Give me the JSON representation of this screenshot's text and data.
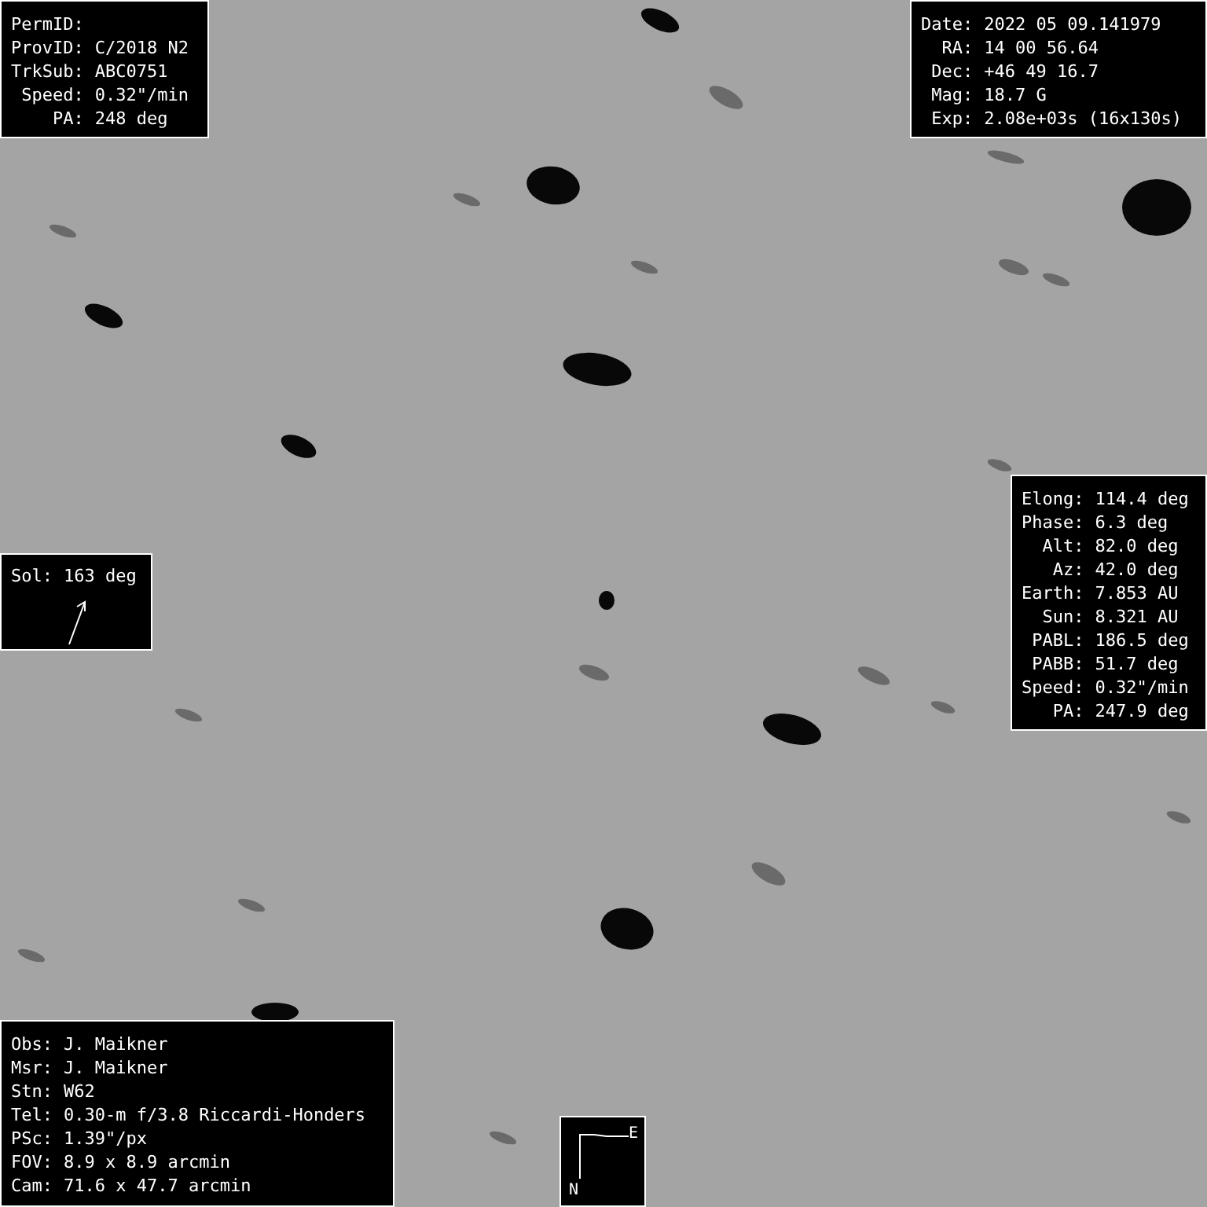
{
  "target_panel": {
    "rows": [
      {
        "label": "PermID:"
      },
      {
        "label": "ProvID:",
        "value": "C/2018 N2"
      },
      {
        "label": "TrkSub:",
        "value": "ABC0751"
      },
      {
        "label": "Speed:",
        "value": "0.32\"/min"
      },
      {
        "label": "PA:",
        "value": "248 deg"
      }
    ]
  },
  "observation_panel": {
    "rows": [
      {
        "label": "Date:",
        "value": "2022 05 09.141979"
      },
      {
        "label": "RA:",
        "value": "14 00 56.64"
      },
      {
        "label": "Dec:",
        "value": "+46 49 16.7"
      },
      {
        "label": "Mag:",
        "value": "18.7 G"
      },
      {
        "label": "Exp:",
        "value": "2.08e+03s (16x130s)"
      }
    ]
  },
  "geometry_panel": {
    "rows": [
      {
        "label": "Elong:",
        "value": "114.4 deg"
      },
      {
        "label": "Phase:",
        "value": "6.3 deg"
      },
      {
        "label": "Alt:",
        "value": "82.0 deg"
      },
      {
        "label": "Az:",
        "value": "42.0 deg"
      },
      {
        "label": "Earth:",
        "value": "7.853 AU"
      },
      {
        "label": "Sun:",
        "value": "8.321 AU"
      },
      {
        "label": "PABL:",
        "value": "186.5 deg"
      },
      {
        "label": "PABB:",
        "value": "51.7 deg"
      },
      {
        "label": "Speed:",
        "value": "0.32\"/min"
      },
      {
        "label": "PA:",
        "value": "247.9 deg"
      }
    ]
  },
  "sol_panel": {
    "label": "Sol:",
    "value": "163 deg"
  },
  "equipment_panel": {
    "rows": [
      {
        "label": "Obs:",
        "value": "J. Maikner"
      },
      {
        "label": "Msr:",
        "value": "J. Maikner"
      },
      {
        "label": "Stn:",
        "value": "W62"
      },
      {
        "label": "Tel:",
        "value": "0.30-m f/3.8 Riccardi-Honders"
      },
      {
        "label": "PSc:",
        "value": "1.39\"/px"
      },
      {
        "label": "FOV:",
        "value": "8.9 x 8.9 arcmin"
      },
      {
        "label": "Cam:",
        "value": "71.6 x 47.7 arcmin"
      }
    ]
  },
  "compass": {
    "east": "E",
    "north": "N"
  }
}
